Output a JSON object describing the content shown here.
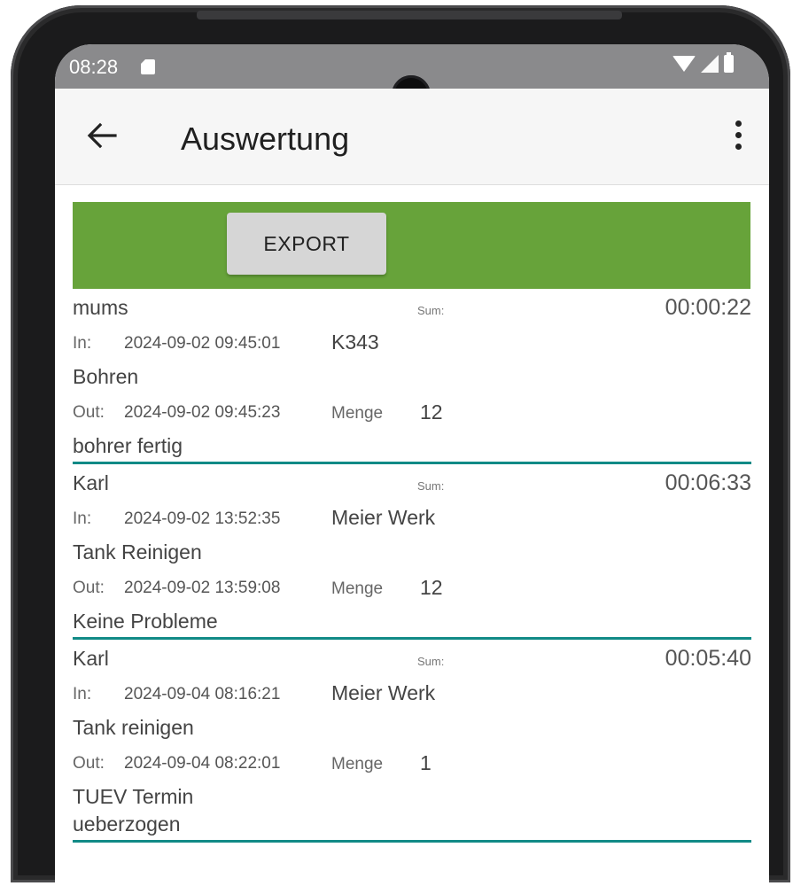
{
  "status_bar": {
    "time": "08:28"
  },
  "app_bar": {
    "title": "Auswertung"
  },
  "toolbar": {
    "export_label": "EXPORT"
  },
  "labels": {
    "sum": "Sum:",
    "in": "In:",
    "out": "Out:",
    "menge": "Menge"
  },
  "records": [
    {
      "name": "mums",
      "duration": "00:00:22",
      "in_time": "2024-09-02 09:45:01",
      "location": "K343",
      "task": "Bohren",
      "out_time": "2024-09-02 09:45:23",
      "menge": "12",
      "comment": "bohrer fertig"
    },
    {
      "name": "Karl",
      "duration": "00:06:33",
      "in_time": "2024-09-02 13:52:35",
      "location": "Meier Werk",
      "task": "Tank Reinigen",
      "out_time": "2024-09-02 13:59:08",
      "menge": "12",
      "comment": "Keine Probleme"
    },
    {
      "name": "Karl",
      "duration": "00:05:40",
      "in_time": "2024-09-04 08:16:21",
      "location": "Meier Werk",
      "task": "Tank reinigen",
      "out_time": "2024-09-04 08:22:01",
      "menge": "1",
      "comment": "TUEV Termin\nueberzogen"
    }
  ],
  "colors": {
    "accent_green": "#67a33a",
    "divider_teal": "#118a86",
    "status_bar": "#8a8a8c"
  },
  "icons": {
    "back": "arrow-left-icon",
    "more": "more-vertical-icon",
    "sd_card": "sd-card-icon",
    "wifi": "wifi-icon",
    "signal": "signal-icon",
    "battery": "battery-icon"
  }
}
